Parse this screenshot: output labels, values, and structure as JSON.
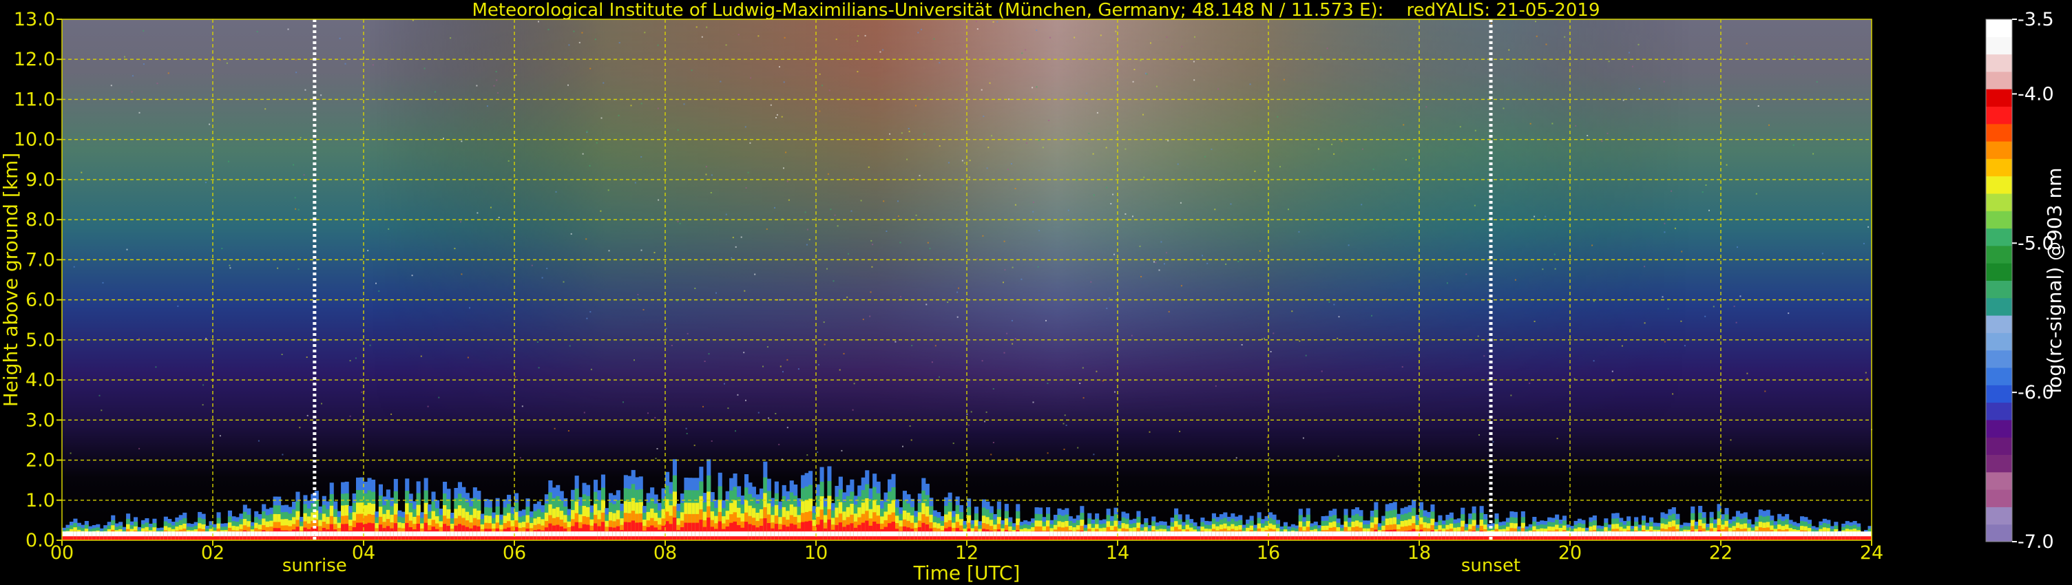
{
  "title": "Meteorological Institute of Ludwig-Maximilians-Universität (München, Germany; 48.148 N / 11.573 E):    redYALIS: 21-05-2019",
  "colors": {
    "background": "#000000",
    "text": "#e8e600",
    "grid": "#d8d400",
    "sun_line": "#ffffff"
  },
  "chart_data": {
    "type": "heatmap",
    "title": "Meteorological Institute of Ludwig-Maximilians-Universität (München, Germany; 48.148 N / 11.573 E):    redYALIS: 21-05-2019",
    "xlabel": "Time [UTC]",
    "ylabel": "Height above ground [km]",
    "xlim": [
      0,
      24
    ],
    "ylim": [
      0,
      13
    ],
    "x_ticks": [
      "00",
      "02",
      "04",
      "06",
      "08",
      "10",
      "12",
      "14",
      "16",
      "18",
      "20",
      "22",
      "24"
    ],
    "x_tick_values": [
      0,
      2,
      4,
      6,
      8,
      10,
      12,
      14,
      16,
      18,
      20,
      22,
      24
    ],
    "y_ticks": [
      "0.0",
      "1.0",
      "2.0",
      "3.0",
      "4.0",
      "5.0",
      "6.0",
      "7.0",
      "8.0",
      "9.0",
      "10.0",
      "11.0",
      "12.0",
      "13.0"
    ],
    "y_tick_values": [
      0,
      1,
      2,
      3,
      4,
      5,
      6,
      7,
      8,
      9,
      10,
      11,
      12,
      13
    ],
    "grid": true,
    "annotations": [
      {
        "label": "sunrise",
        "time": 3.35
      },
      {
        "label": "sunset",
        "time": 18.95
      }
    ],
    "colorbar": {
      "label": "log(rc-signal) @903 nm",
      "range": [
        -7.0,
        -3.5
      ],
      "ticks": [
        "-3.5",
        "-4.0",
        "-5.0",
        "-6.0",
        "-7.0"
      ],
      "tick_values": [
        -3.5,
        -4.0,
        -5.0,
        -6.0,
        -7.0
      ],
      "colors": [
        "#8878b8",
        "#9a88c0",
        "#a85890",
        "#b06898",
        "#7a2a7a",
        "#6a1a7a",
        "#5a108a",
        "#3a38b8",
        "#2a58d8",
        "#3a78e0",
        "#5a90e0",
        "#7aa8e0",
        "#90b0e0",
        "#2a9a8a",
        "#3aaa6a",
        "#1a8a2a",
        "#2a9a3a",
        "#3ab06a",
        "#7ad04a",
        "#b0e040",
        "#f0f020",
        "#ffc000",
        "#ff9000",
        "#ff5000",
        "#ff1a1a",
        "#e00000",
        "#e8b0b0",
        "#f0d0d0",
        "#f8f8f8",
        "#ffffff"
      ]
    },
    "signal_profile": {
      "description_values_hours": [
        0,
        2,
        4,
        6,
        8,
        10,
        11,
        12,
        14,
        16,
        18,
        20,
        22,
        24
      ],
      "cloud_top_km": [
        0.6,
        0.7,
        1.6,
        1.3,
        2.0,
        1.8,
        1.8,
        1.0,
        0.8,
        0.7,
        1.0,
        0.6,
        0.9,
        0.4
      ]
    }
  }
}
